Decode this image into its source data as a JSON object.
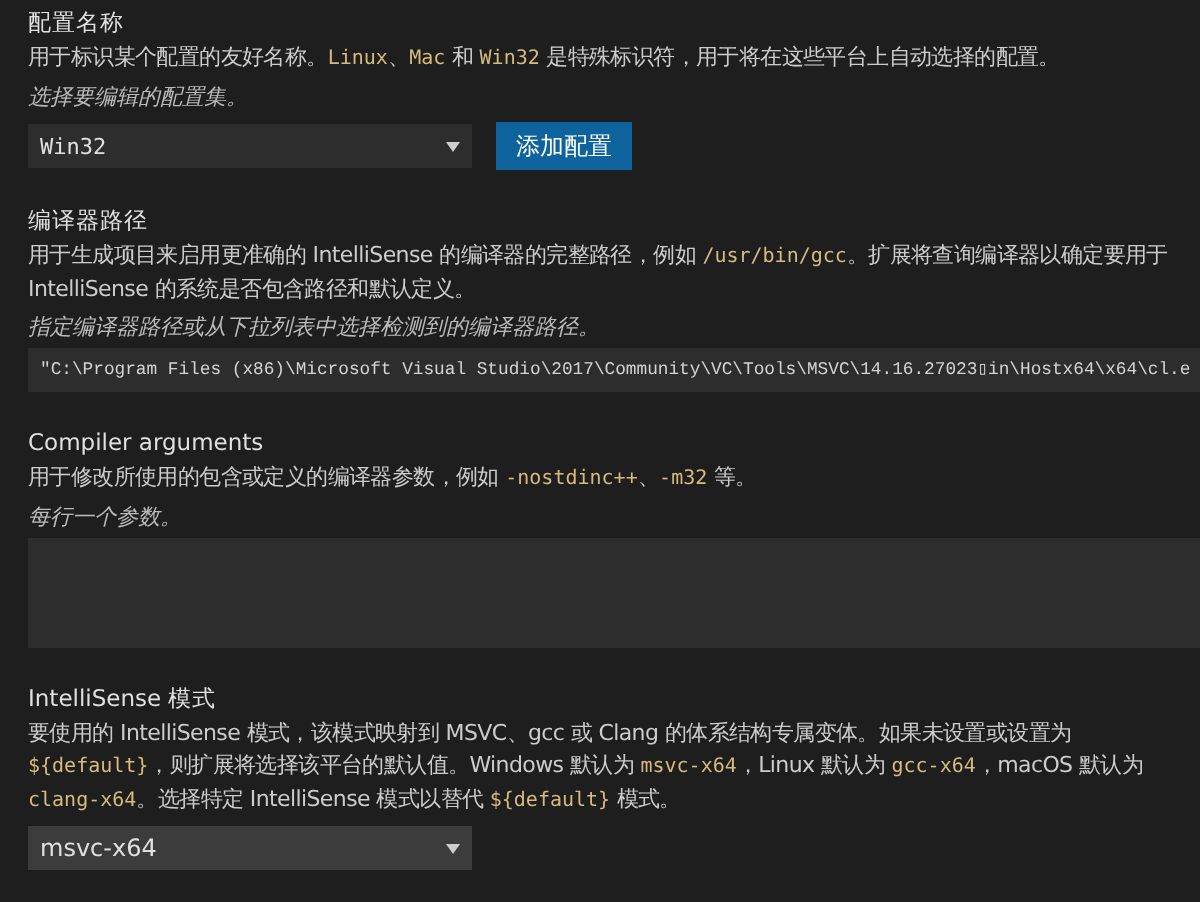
{
  "sections": [
    {
      "kind": "select",
      "title": "配置名称",
      "description": [
        {
          "kind": "text",
          "text": "用于标识某个配置的友好名称。"
        },
        {
          "kind": "code",
          "text": "Linux"
        },
        {
          "kind": "text",
          "text": "、"
        },
        {
          "kind": "code",
          "text": "Mac"
        },
        {
          "kind": "text",
          "text": " 和 "
        },
        {
          "kind": "code",
          "text": "Win32"
        },
        {
          "kind": "text",
          "text": " 是特殊标识符，用于将在这些平台上自动选择的配置。"
        }
      ],
      "hint": "选择要编辑的配置集。",
      "value": "Win32",
      "mono": true,
      "button": "添加配置"
    },
    {
      "kind": "input",
      "title": "编译器路径",
      "description": [
        {
          "kind": "text",
          "text": "用于生成项目来启用更准确的 IntelliSense 的编译器的完整路径，例如 "
        },
        {
          "kind": "code",
          "text": "/usr/bin/gcc"
        },
        {
          "kind": "text",
          "text": "。扩展将查询编译器以确定要用于 IntelliSense 的系统是否包含路径和默认定义。"
        }
      ],
      "hint": "指定编译器路径或从下拉列表中选择检测到的编译器路径。",
      "value": "\"C:\\Program Files (x86)\\Microsoft Visual Studio\\2017\\Community\\VC\\Tools\\MSVC\\14.16.27023▯in\\Hostx64\\x64\\cl.e"
    },
    {
      "kind": "textarea",
      "title": "Compiler arguments",
      "description": [
        {
          "kind": "text",
          "text": "用于修改所使用的包含或定义的编译器参数，例如 "
        },
        {
          "kind": "code",
          "text": "-nostdinc++"
        },
        {
          "kind": "text",
          "text": "、"
        },
        {
          "kind": "code",
          "text": "-m32"
        },
        {
          "kind": "text",
          "text": " 等。"
        }
      ],
      "hint": "每行一个参数。"
    },
    {
      "kind": "select",
      "title": "IntelliSense 模式",
      "description": [
        {
          "kind": "text",
          "text": "要使用的 IntelliSense 模式，该模式映射到 MSVC、gcc 或 Clang 的体系结构专属变体。如果未设置或设置为 "
        },
        {
          "kind": "code",
          "text": "${default}"
        },
        {
          "kind": "text",
          "text": "，则扩展将选择该平台的默认值。Windows 默认为 "
        },
        {
          "kind": "code",
          "text": "msvc-x64"
        },
        {
          "kind": "text",
          "text": "，Linux 默认为 "
        },
        {
          "kind": "code",
          "text": "gcc-x64"
        },
        {
          "kind": "text",
          "text": "，macOS 默认为 "
        },
        {
          "kind": "code",
          "text": "clang-x64"
        },
        {
          "kind": "text",
          "text": "。选择特定 IntelliSense 模式以替代 "
        },
        {
          "kind": "code",
          "text": "${default}"
        },
        {
          "kind": "text",
          "text": " 模式。"
        }
      ],
      "value": "msvc-x64",
      "mono": false
    }
  ]
}
